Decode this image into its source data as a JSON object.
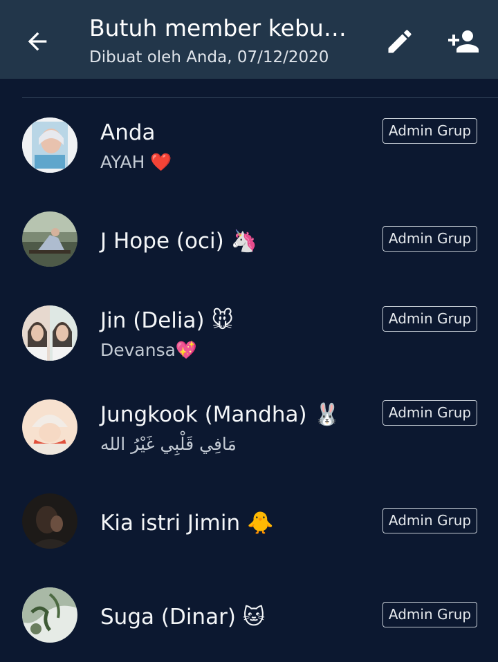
{
  "header": {
    "title": "Butuh member kebu…",
    "subtitle": "Dibuat oleh Anda, 07/12/2020",
    "back_icon": "arrow-back-icon",
    "edit_icon": "pencil-icon",
    "add_member_icon": "person-add-icon"
  },
  "members": [
    {
      "name": "Anda",
      "status": "AYAH ❤️",
      "badge": "Admin Grup"
    },
    {
      "name": "J Hope (oci) 🦄",
      "status": "",
      "badge": "Admin Grup"
    },
    {
      "name": "Jin (Delia) 🐭",
      "status": "Devansa💖",
      "badge": "Admin Grup"
    },
    {
      "name": "Jungkook (Mandha) 🐰",
      "status": "مَافِي قَلْبِي غَيْرُ الله",
      "badge": "Admin Grup"
    },
    {
      "name": "Kia istri Jimin 🐥",
      "status": "",
      "badge": "Admin Grup"
    },
    {
      "name": "Suga (Dinar) 🐱",
      "status": "",
      "badge": "Admin Grup"
    }
  ],
  "colors": {
    "background": "#0c1830",
    "appbar": "#22364a",
    "text": "#f4f6f8",
    "secondary_text": "#c4cbd4"
  }
}
